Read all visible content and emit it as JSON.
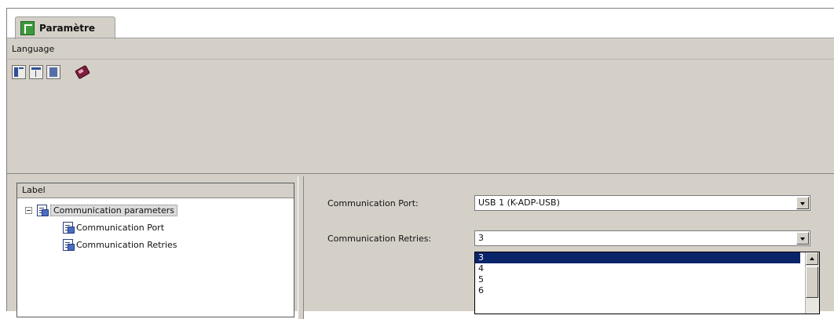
{
  "window": {
    "tab_label": "Paramètre"
  },
  "menu": {
    "language": "Language"
  },
  "toolbar": {
    "icons": [
      "layout-left-icon",
      "layout-top-icon",
      "layout-right-icon",
      "eraser-icon"
    ]
  },
  "left_panel": {
    "header": "Label",
    "tree": {
      "root": "Communication parameters",
      "children": [
        "Communication Port",
        "Communication Retries"
      ]
    }
  },
  "form": {
    "port_label": "Communication Port:",
    "port_value": "USB 1 (K-ADP-USB)",
    "retries_label": "Communication Retries:",
    "retries_value": "3",
    "retries_options": [
      "3",
      "4",
      "5",
      "6"
    ]
  }
}
